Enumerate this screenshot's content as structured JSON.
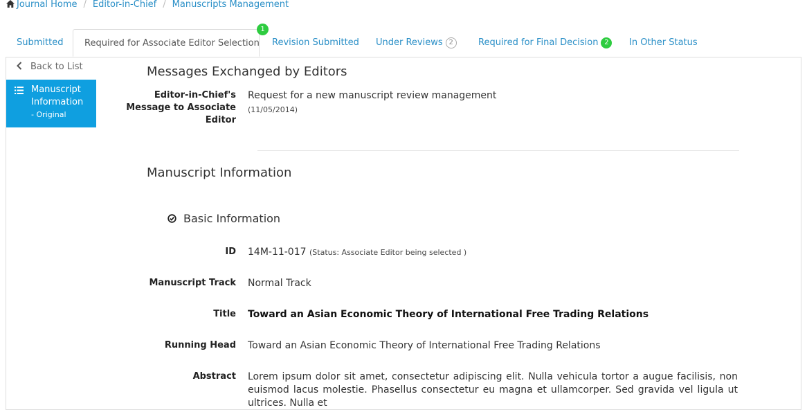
{
  "breadcrumb": {
    "items": [
      "Journal Home",
      "Editor-in-Chief",
      "Manuscripts Management"
    ],
    "separator": "/"
  },
  "tabs": [
    {
      "label": "Submitted"
    },
    {
      "label": "Required for Associate Editor Selection",
      "badge": "1"
    },
    {
      "label": "Revision Submitted"
    },
    {
      "label": "Under Reviews",
      "badge": "2"
    },
    {
      "label": "Required for Final Decision",
      "badge": "2"
    },
    {
      "label": "In Other Status"
    }
  ],
  "sidebar": {
    "back_label": "Back to List",
    "item_line1": "Manuscript",
    "item_line2": "Information",
    "item_sub": "- Original"
  },
  "messages": {
    "heading": "Messages Exchanged by Editors",
    "label_line1": "Editor-in-Chief's",
    "label_line2": "Message to Associate",
    "label_line3": "Editor",
    "text": "Request for a new manuscript review management",
    "date": "(11/05/2014)"
  },
  "manuscript": {
    "heading": "Manuscript Information",
    "basic_heading": "Basic Information",
    "id_label": "ID",
    "id_value": "14M-11-017",
    "id_status": "(Status: Associate Editor being selected )",
    "track_label": "Manuscript Track",
    "track_value": "Normal Track",
    "title_label": "Title",
    "title_value": "Toward an Asian Economic Theory of International Free Trading Relations",
    "running_label": "Running Head",
    "running_value": "Toward an Asian Economic Theory of International Free Trading Relations",
    "abstract_label": "Abstract",
    "abstract_value": "Lorem ipsum dolor sit amet, consectetur adipiscing elit. Nulla vehicula tortor a augue facilisis, non euismod lacus molestie. Phasellus consectetur eu magna et ullamcorper. Sed gravida vel ligula ut ultrices. Nulla et"
  },
  "colors": {
    "link": "#2a8fc7",
    "sidebar_active": "#0f9fe0",
    "badge_green": "#2ecc40"
  }
}
